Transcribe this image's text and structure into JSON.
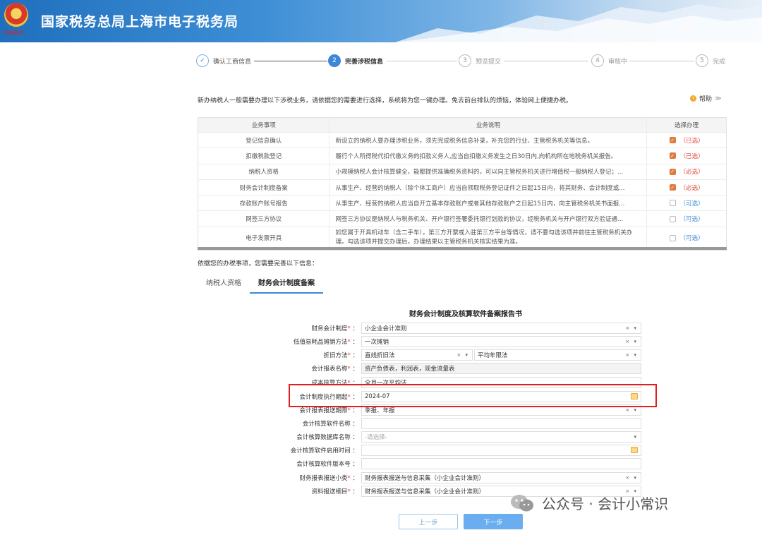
{
  "header": {
    "title": "国家税务总局上海市电子税务局",
    "emblem_caption": "中国税务",
    "bg_color": "#1f6fbd"
  },
  "stepper": {
    "steps": [
      {
        "num": "✓",
        "label": "确认工商信息",
        "state": "done"
      },
      {
        "num": "2",
        "label": "完善涉税信息",
        "state": "active"
      },
      {
        "num": "3",
        "label": "预览提交",
        "state": "todo"
      },
      {
        "num": "4",
        "label": "审核中",
        "state": "todo"
      },
      {
        "num": "5",
        "label": "完成",
        "state": "todo"
      }
    ]
  },
  "intro": "新办纳税人一般需要办理以下涉税业务，请依据您的需要进行选择，系统将为您一键办理。免去前台排队的烦恼，体验网上便捷办税。",
  "help": {
    "icon": "question-icon",
    "label": "帮助",
    "chevron": "≫"
  },
  "table": {
    "headers": [
      "业务事项",
      "业务说明",
      "选择办理"
    ],
    "rows": [
      {
        "item": "登记信息确认",
        "desc": "新设立的纳税人要办理涉税业务，须先完成税务信息补录，补充您的行业、主管税务机关等信息。",
        "checked": true,
        "tag": "（已选）",
        "tag_color": "red"
      },
      {
        "item": "扣缴税款登记",
        "desc": "履行个人所得税代扣代缴义务的扣款义务人,应当自扣缴义务发生之日30日内,向机构所在地税务机关报告。",
        "checked": true,
        "tag": "（已选）",
        "tag_color": "red"
      },
      {
        "item": "纳税人资格",
        "desc": "小规模纳税人会计核算健全，能都提供准确税务资料的，可以向主管税务机关进行增值税一般纳税人登记；...",
        "checked": true,
        "tag": "（必选）",
        "tag_color": "red"
      },
      {
        "item": "财务会计制度备案",
        "desc": "从事生产、经营的纳税人（除个体工商户）应当自领取税务登记证件之日起15日内，将其财务、会计制度或...",
        "checked": true,
        "tag": "（必选）",
        "tag_color": "red"
      },
      {
        "item": "存款账户账号报告",
        "desc": "从事生产、经营的纳税人应当自开立基本存款账户或者其他存款账户之日起15日内，向主管税务机关书面报...",
        "checked": false,
        "tag": "（可选）",
        "tag_color": "blue"
      },
      {
        "item": "网签三方协议",
        "desc": "网签三方协议是纳税人与税务机关、开户银行签署委托银行划款的协议，经税务机关与开户银行双方验证通...",
        "checked": false,
        "tag": "（可选）",
        "tag_color": "blue"
      },
      {
        "item": "电子发票开具",
        "desc": "如您属于开具机动车（含二手车），第三方开票或入驻第三方平台等情况，请不要勾选该项并前往主管税务机关办理。勾选该项并提交办理后，办理结果以主管税务机关核实结果为准。",
        "checked": false,
        "tag": "（可选）",
        "tag_color": "blue"
      }
    ]
  },
  "subintro": "依据您的办税事项，您需要完善以下信息：",
  "tabs": [
    {
      "label": "纳税人资格",
      "active": false
    },
    {
      "label": "财务会计制度备案",
      "active": true
    }
  ],
  "form": {
    "title": "财务会计制度及核算软件备案报告书",
    "fields": [
      {
        "label": "财务会计制度",
        "required": true,
        "value": "小企业会计准则",
        "ctl": "× ▾",
        "gray": false
      },
      {
        "label": "低值易耗品摊销方法",
        "required": true,
        "value": "一次摊销",
        "ctl": "× ▾",
        "gray": false
      },
      {
        "label": "折旧方法",
        "required": true,
        "value": "直线折旧法",
        "ctl": "× ▾",
        "value2": "平均年限法",
        "ctl2": "× ▾"
      },
      {
        "label": "会计报表名称",
        "required": true,
        "value": "资产负债表，利润表，现金流量表",
        "ctl": "",
        "gray": true
      },
      {
        "label": "成本核算方法",
        "required": true,
        "value": "全月一次平均法",
        "ctl": "",
        "gray": false
      },
      {
        "label": "会计制度执行期起",
        "required": true,
        "value": "2024-07",
        "ctl": "cal",
        "gray": false
      },
      {
        "label": "会计报表报送期限",
        "required": true,
        "value": "季报、年报",
        "ctl": "× ▾",
        "gray": false
      },
      {
        "label": "会计核算软件名称",
        "required": false,
        "value": "",
        "ctl": "",
        "gray": false
      },
      {
        "label": "会计核算数据库名称",
        "required": false,
        "value": "-请选择-",
        "placeholder": true,
        "ctl": "▾",
        "gray": false
      },
      {
        "label": "会计核算软件启用时间",
        "required": false,
        "value": "",
        "ctl": "cal",
        "gray": false
      },
      {
        "label": "会计核算软件版本号",
        "required": false,
        "value": "",
        "ctl": "",
        "gray": false
      },
      {
        "label": "财务报表报送小类",
        "required": true,
        "value": "财务报表报送与信息采集（小企业会计准则）",
        "ctl": "× ▾",
        "gray": false
      },
      {
        "label": "资料报送细目",
        "required": true,
        "value": "财务报表报送与信息采集（小企业会计准则）",
        "ctl": "× ▾",
        "gray": false
      }
    ]
  },
  "buttons": {
    "prev": "上一步",
    "next": "下一步"
  },
  "watermark": "公众号 · 会计小常识",
  "colors": {
    "primary": "#3b88d8",
    "checked": "#e07a3c",
    "required_red": "#e0463a",
    "highlight": "#e02020"
  }
}
